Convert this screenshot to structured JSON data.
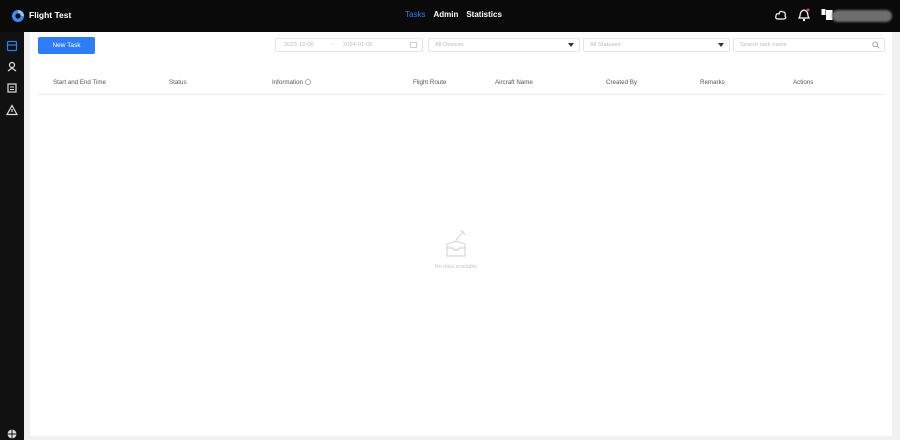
{
  "app": {
    "title": "Flight Test"
  },
  "nav": {
    "tabs": [
      "Tasks",
      "Admin",
      "Statistics"
    ],
    "active": "Tasks"
  },
  "toolbar": {
    "new_task_label": "New Task",
    "date_start": "2023-12-06",
    "date_separator": "~",
    "date_end": "2024-01-05",
    "devices_value": "All Devices",
    "statuses_value": "All Statuses",
    "search_placeholder": "Search task name"
  },
  "table": {
    "columns": [
      "Start and End Time",
      "Status",
      "Information",
      "Flight Route",
      "Aircraft Name",
      "Created By",
      "Remarks",
      "Actions"
    ]
  },
  "empty_state": {
    "text": "No data available"
  },
  "colors": {
    "accent": "#2f7df6",
    "topbar": "#0a0a0a",
    "sidebar": "#111111"
  }
}
